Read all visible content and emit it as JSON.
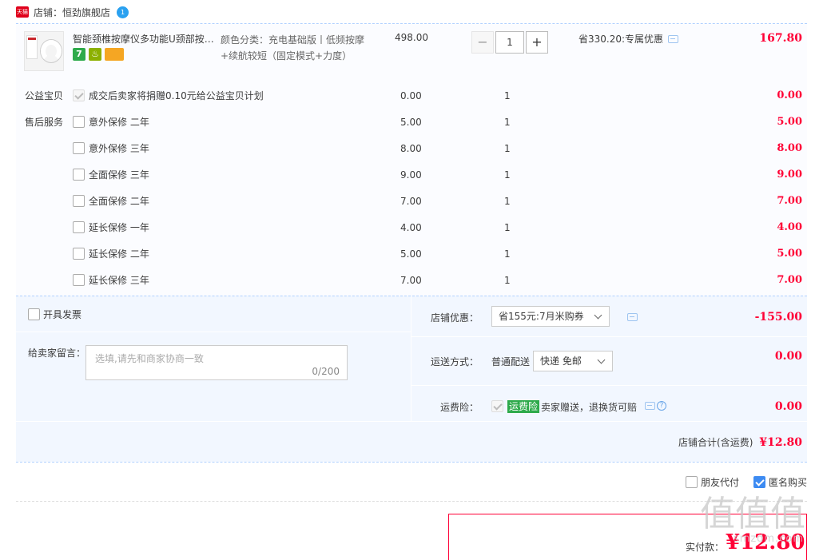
{
  "shop": {
    "badge": "天猫",
    "label": "店铺：恒劲旗舰店",
    "ww": "1"
  },
  "item": {
    "title": "智能颈椎按摩仪多功能U颈部按摩器",
    "badges": [
      "7",
      "♨",
      ""
    ],
    "sku": "颜色分类：充电基础版丨低频按摩+续航较短（固定模式+力度）",
    "unit_price": "498.00",
    "qty": "1",
    "qty_minus": "−",
    "qty_plus": "+",
    "promo": "省330.20:专属优惠",
    "total": "167.80"
  },
  "charity": {
    "head": "公益宝贝",
    "name": "成交后卖家将捐赠0.10元给公益宝贝计划",
    "price": "0.00",
    "qty": "1",
    "total": "0.00"
  },
  "services": {
    "head": "售后服务",
    "items": [
      {
        "name": "意外保修 二年",
        "price": "5.00",
        "qty": "1",
        "total": "5.00"
      },
      {
        "name": "意外保修 三年",
        "price": "8.00",
        "qty": "1",
        "total": "8.00"
      },
      {
        "name": "全面保修 三年",
        "price": "9.00",
        "qty": "1",
        "total": "9.00"
      },
      {
        "name": "全面保修 二年",
        "price": "7.00",
        "qty": "1",
        "total": "7.00"
      },
      {
        "name": "延长保修 一年",
        "price": "4.00",
        "qty": "1",
        "total": "4.00"
      },
      {
        "name": "延长保修 二年",
        "price": "5.00",
        "qty": "1",
        "total": "5.00"
      },
      {
        "name": "延长保修 三年",
        "price": "7.00",
        "qty": "1",
        "total": "7.00"
      }
    ]
  },
  "invoice": {
    "label": "开具发票"
  },
  "message": {
    "label": "给卖家留言：",
    "placeholder": "选填,请先和商家协商一致",
    "count": "0/200"
  },
  "discount": {
    "label": "店铺优惠：",
    "selected": "省155元:7月米购券",
    "amount": "-155.00"
  },
  "shipping": {
    "label": "运送方式：",
    "type": "普通配送",
    "selected": "快递 免邮",
    "amount": "0.00"
  },
  "insurance": {
    "label": "运费险：",
    "tag": "运费险",
    "text": "卖家赠送，退换货可赔",
    "help": "?",
    "amount": "0.00"
  },
  "subtotal": {
    "label": "店铺合计(含运费)",
    "amount": "¥12.80"
  },
  "options": {
    "friend_pay": "朋友代付",
    "anonymous": "匿名购买"
  },
  "payment": {
    "label": "实付款：",
    "amount": "¥12.80"
  },
  "watermark": {
    "big": "值值值",
    "small": "smzdm.com"
  },
  "colors": {
    "price_red": "#ff0036",
    "accent_blue": "#3d8bf2",
    "panel_bg": "#f2f7ff",
    "green_tag": "#2eaa4b"
  }
}
